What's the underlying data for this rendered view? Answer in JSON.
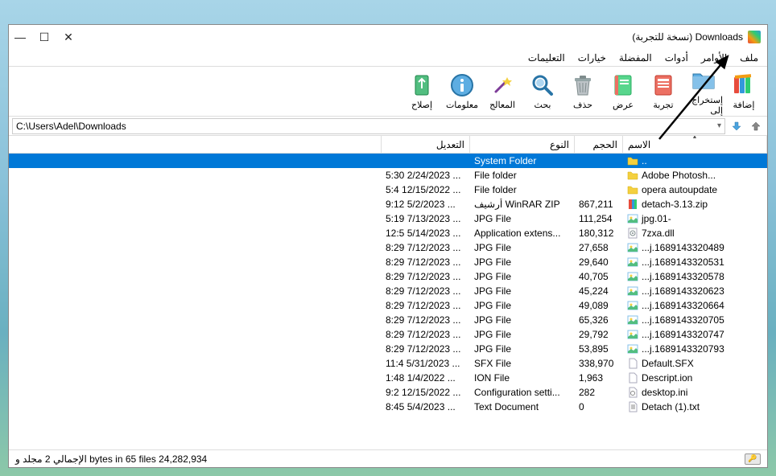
{
  "title": "Downloads (نسخة للتجربة)",
  "menu": [
    "ملف",
    "الأوامر",
    "أدوات",
    "المفضلة",
    "خيارات",
    "التعليمات"
  ],
  "toolbar": [
    {
      "id": "add",
      "label": "إضافة",
      "svg": "books"
    },
    {
      "id": "extract",
      "label": "إستخراج إلى",
      "svg": "folder"
    },
    {
      "id": "test",
      "label": "تجربة",
      "svg": "testbook"
    },
    {
      "id": "view",
      "label": "عرض",
      "svg": "notebook"
    },
    {
      "id": "delete",
      "label": "حذف",
      "svg": "trash"
    },
    {
      "id": "find",
      "label": "بحث",
      "svg": "magnify"
    },
    {
      "id": "wizard",
      "label": "المعالج",
      "svg": "wand"
    },
    {
      "id": "info",
      "label": "معلومات",
      "svg": "info"
    },
    {
      "id": "repair",
      "label": "إصلاح",
      "svg": "repair"
    }
  ],
  "path": "C:\\Users\\Adel\\Downloads",
  "columns": {
    "name": "الاسم",
    "size": "الحجم",
    "type": "النوع",
    "mod": "التعديل"
  },
  "rows": [
    {
      "sel": true,
      "icon": "folder",
      "name": "..",
      "size": "",
      "type": "System Folder",
      "mod": ""
    },
    {
      "icon": "folder",
      "name": "Adobe Photosh...",
      "size": "",
      "type": "File folder",
      "mod": "5:30 2/24/2023 ..."
    },
    {
      "icon": "folder",
      "name": "opera autoupdate",
      "size": "",
      "type": "File folder",
      "mod": "5:4 12/15/2022 ..."
    },
    {
      "icon": "zip",
      "name": "detach-3.13.zip",
      "size": "867,211",
      "type": "أرشيف WinRAR ZIP",
      "mod": "9:12 5/2/2023 ..."
    },
    {
      "icon": "jpg",
      "name": "jpg.01-",
      "size": "111,254",
      "type": "JPG File",
      "mod": "5:19 7/13/2023 ..."
    },
    {
      "icon": "dll",
      "name": "7zxa.dll",
      "size": "180,312",
      "type": "Application extens...",
      "mod": "12:5 5/14/2023 ..."
    },
    {
      "icon": "jpg",
      "name": "...j.1689143320489",
      "size": "27,658",
      "type": "JPG File",
      "mod": "8:29 7/12/2023 ..."
    },
    {
      "icon": "jpg",
      "name": "...j.1689143320531",
      "size": "29,640",
      "type": "JPG File",
      "mod": "8:29 7/12/2023 ..."
    },
    {
      "icon": "jpg",
      "name": "...j.1689143320578",
      "size": "40,705",
      "type": "JPG File",
      "mod": "8:29 7/12/2023 ..."
    },
    {
      "icon": "jpg",
      "name": "...j.1689143320623",
      "size": "45,224",
      "type": "JPG File",
      "mod": "8:29 7/12/2023 ..."
    },
    {
      "icon": "jpg",
      "name": "...j.1689143320664",
      "size": "49,089",
      "type": "JPG File",
      "mod": "8:29 7/12/2023 ..."
    },
    {
      "icon": "jpg",
      "name": "...j.1689143320705",
      "size": "65,326",
      "type": "JPG File",
      "mod": "8:29 7/12/2023 ..."
    },
    {
      "icon": "jpg",
      "name": "...j.1689143320747",
      "size": "29,792",
      "type": "JPG File",
      "mod": "8:29 7/12/2023 ..."
    },
    {
      "icon": "jpg",
      "name": "...j.1689143320793",
      "size": "53,895",
      "type": "JPG File",
      "mod": "8:29 7/12/2023 ..."
    },
    {
      "icon": "file",
      "name": "Default.SFX",
      "size": "338,970",
      "type": "SFX File",
      "mod": "11:4 5/31/2023 ..."
    },
    {
      "icon": "file",
      "name": "Descript.ion",
      "size": "1,963",
      "type": "ION File",
      "mod": "1:48 1/4/2022 ..."
    },
    {
      "icon": "ini",
      "name": "desktop.ini",
      "size": "282",
      "type": "Configuration setti...",
      "mod": "9:2 12/15/2022 ..."
    },
    {
      "icon": "txt",
      "name": "Detach (1).txt",
      "size": "0",
      "type": "Text Document",
      "mod": "8:45 5/4/2023 ..."
    }
  ],
  "status": "الإجمالي 2 مجلد  و  bytes in 65 files 24,282,934"
}
